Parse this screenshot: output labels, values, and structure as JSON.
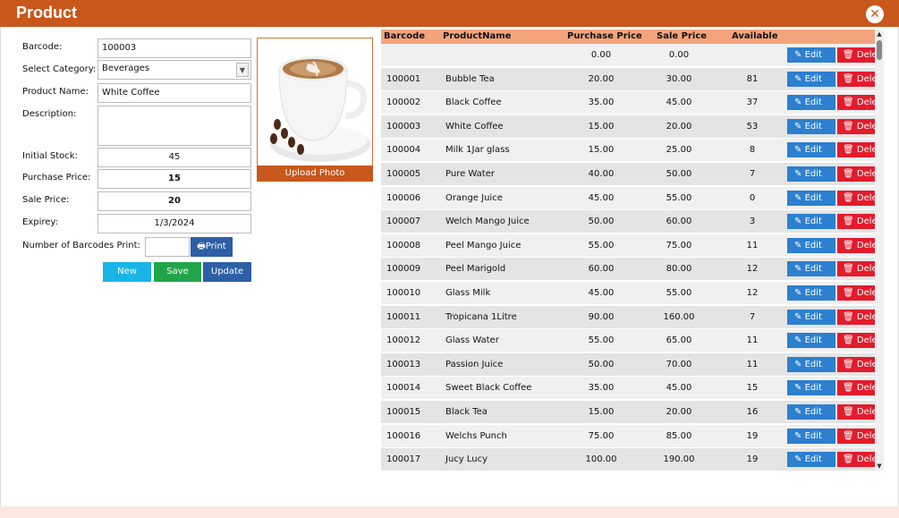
{
  "window": {
    "title": "Product",
    "close_icon": "close-icon"
  },
  "form": {
    "barcode_label": "Barcode:",
    "barcode_value": "100003",
    "category_label": "Select Category:",
    "category_value": "Beverages",
    "product_name_label": "Product Name:",
    "product_name_value": "White Coffee",
    "description_label": "Description:",
    "description_value": "",
    "initial_stock_label": "Initial Stock:",
    "initial_stock_value": "45",
    "purchase_price_label": "Purchase Price:",
    "purchase_price_value": "15",
    "sale_price_label": "Sale Price:",
    "sale_price_value": "20",
    "expiry_label": "Expirey:",
    "expiry_value": "1/3/2024",
    "barcodes_print_label": "Number of Barcodes Print:",
    "barcodes_print_value": "",
    "print_label": "Print",
    "new_label": "New",
    "save_label": "Save",
    "update_label": "Update",
    "upload_photo_label": "Upload Photo"
  },
  "grid": {
    "headers": [
      "Barcode",
      "ProductName",
      "Purchase Price",
      "Sale Price",
      "Available"
    ],
    "edit_label": "Edit",
    "delete_label": "Delete",
    "rows": [
      {
        "barcode": "",
        "name": "",
        "purchase": "0.00",
        "sale": "0.00",
        "available": ""
      },
      {
        "barcode": "100001",
        "name": "Bubble Tea",
        "purchase": "20.00",
        "sale": "30.00",
        "available": "81"
      },
      {
        "barcode": "100002",
        "name": "Black Coffee",
        "purchase": "35.00",
        "sale": "45.00",
        "available": "37"
      },
      {
        "barcode": "100003",
        "name": "White Coffee",
        "purchase": "15.00",
        "sale": "20.00",
        "available": "53"
      },
      {
        "barcode": "100004",
        "name": "Milk 1Jar glass",
        "purchase": "15.00",
        "sale": "25.00",
        "available": "8"
      },
      {
        "barcode": "100005",
        "name": "Pure Water",
        "purchase": "40.00",
        "sale": "50.00",
        "available": "7"
      },
      {
        "barcode": "100006",
        "name": "Orange Juice",
        "purchase": "45.00",
        "sale": "55.00",
        "available": "0"
      },
      {
        "barcode": "100007",
        "name": "Welch Mango Juice",
        "purchase": "50.00",
        "sale": "60.00",
        "available": "3"
      },
      {
        "barcode": "100008",
        "name": "Peel Mango Juice",
        "purchase": "55.00",
        "sale": "75.00",
        "available": "11"
      },
      {
        "barcode": "100009",
        "name": "Peel Marigold",
        "purchase": "60.00",
        "sale": "80.00",
        "available": "12"
      },
      {
        "barcode": "100010",
        "name": "Glass Milk",
        "purchase": "45.00",
        "sale": "55.00",
        "available": "12"
      },
      {
        "barcode": "100011",
        "name": "Tropicana 1Litre",
        "purchase": "90.00",
        "sale": "160.00",
        "available": "7"
      },
      {
        "barcode": "100012",
        "name": "Glass Water",
        "purchase": "55.00",
        "sale": "65.00",
        "available": "11"
      },
      {
        "barcode": "100013",
        "name": "Passion Juice",
        "purchase": "50.00",
        "sale": "70.00",
        "available": "11"
      },
      {
        "barcode": "100014",
        "name": "Sweet Black Coffee",
        "purchase": "35.00",
        "sale": "45.00",
        "available": "15"
      },
      {
        "barcode": "100015",
        "name": "Black Tea",
        "purchase": "15.00",
        "sale": "20.00",
        "available": "16"
      },
      {
        "barcode": "100016",
        "name": "Welchs Punch",
        "purchase": "75.00",
        "sale": "85.00",
        "available": "19"
      },
      {
        "barcode": "100017",
        "name": "Jucy Lucy",
        "purchase": "100.00",
        "sale": "190.00",
        "available": "19"
      }
    ]
  },
  "colors": {
    "accent": "#c8571c",
    "header": "#f4a47c",
    "edit": "#2d7fd0",
    "delete": "#e21c2c"
  }
}
